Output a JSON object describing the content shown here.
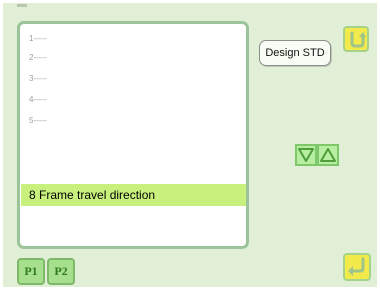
{
  "list": {
    "rows": [
      {
        "label": "1-----"
      },
      {
        "label": "2-----"
      },
      {
        "label": "3-----"
      },
      {
        "label": "4-----"
      },
      {
        "label": "5-----"
      }
    ],
    "selected_label": "8 Frame travel direction"
  },
  "pager": {
    "tabs": [
      {
        "label": "P1"
      },
      {
        "label": "P2"
      }
    ]
  },
  "design_button_label": "Design STD",
  "icons": {
    "rotate": "rotate-arrow-icon",
    "down": "triangle-down-icon",
    "up": "triangle-up-icon",
    "enter": "enter-return-icon"
  },
  "colors": {
    "background": "#e1efd6",
    "highlight": "#c8f07c",
    "accent_button": "#f2e94a",
    "arrow_button": "#b7eea2"
  }
}
